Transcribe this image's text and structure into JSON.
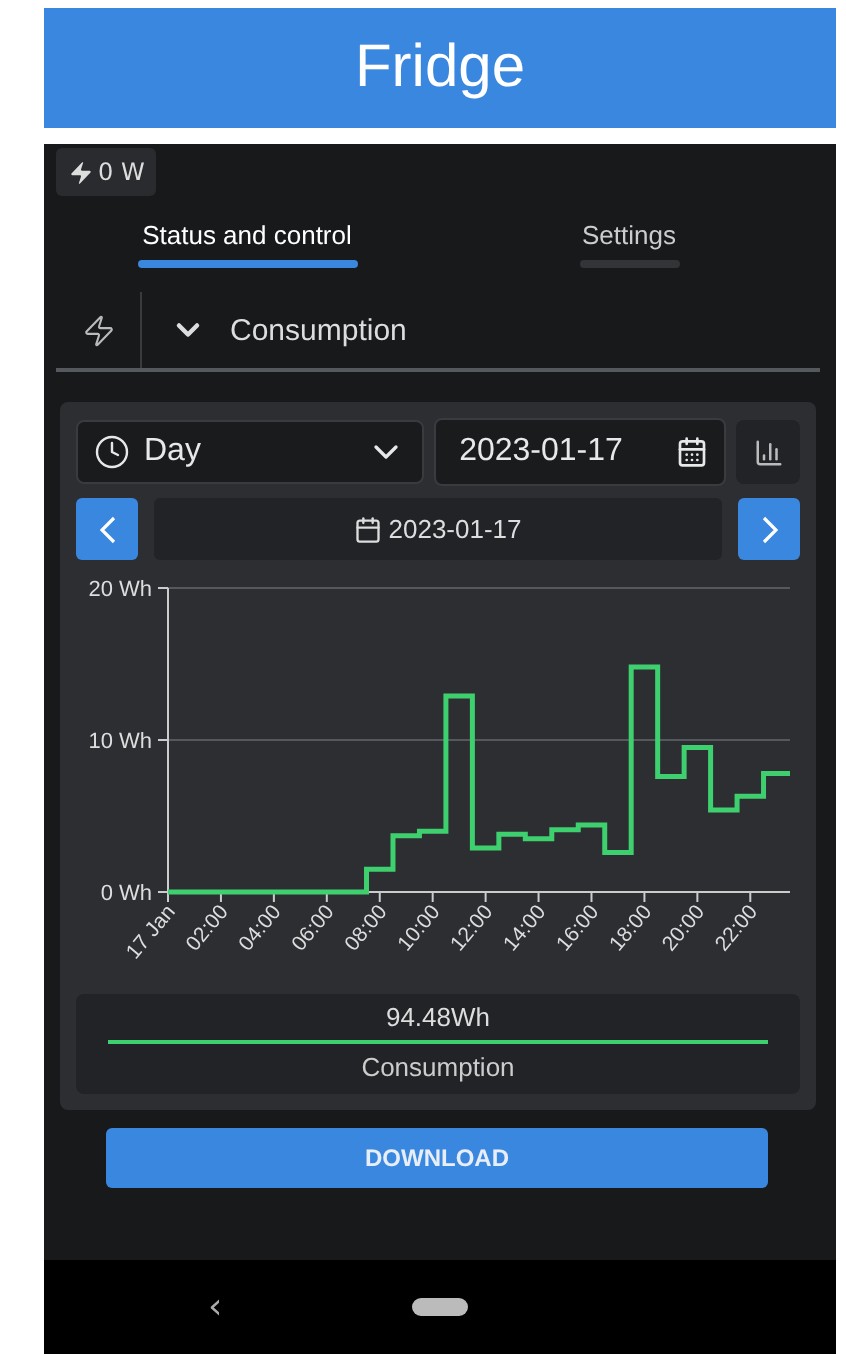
{
  "header": {
    "title": "Fridge"
  },
  "power_badge": {
    "value": "0 W"
  },
  "tabs": [
    {
      "label": "Status and control",
      "selected": true
    },
    {
      "label": "Settings",
      "selected": false
    }
  ],
  "section": {
    "title": "Consumption",
    "expanded": true
  },
  "period_select": {
    "value": "Day"
  },
  "date_field": {
    "value": "2023-01-17"
  },
  "date_nav": {
    "label": "2023-01-17"
  },
  "chart": {
    "chart_data": {
      "type": "line",
      "x": [
        0,
        0.5,
        0.5,
        1.5,
        1.5,
        2.5,
        2.5,
        3.5,
        3.5,
        4.5,
        4.5,
        5.5,
        5.5,
        6.5,
        6.5,
        7.5,
        7.5,
        8.5,
        8.5,
        9.5,
        9.5,
        10.5,
        10.5,
        11.5,
        11.5,
        12.5,
        12.5,
        13.5,
        13.5,
        14.5,
        14.5,
        15.5,
        15.5,
        16.5,
        16.5,
        17.5,
        17.5,
        18.5,
        18.5,
        19.5,
        19.5,
        20.5,
        20.5,
        21.5,
        21.5,
        22.5,
        22.5,
        23.5
      ],
      "series": [
        {
          "name": "Consumption",
          "color": "#3ecf6e",
          "values": [
            0,
            0,
            0,
            0,
            0,
            0,
            0,
            0,
            0,
            0,
            0,
            0,
            0,
            0,
            0,
            0,
            1.5,
            1.5,
            3.7,
            3.7,
            4.0,
            4.0,
            12.9,
            12.9,
            2.9,
            2.9,
            3.8,
            3.8,
            3.5,
            3.5,
            4.1,
            4.1,
            4.4,
            4.4,
            2.6,
            2.6,
            14.8,
            14.8,
            7.6,
            7.6,
            9.5,
            9.5,
            5.4,
            5.4,
            6.3,
            6.3,
            7.8,
            7.8
          ]
        }
      ],
      "xlim": [
        0,
        23.5
      ],
      "ylim": [
        0,
        20
      ],
      "xticks": [
        {
          "value": 0,
          "label": "17 Jan"
        },
        {
          "value": 2,
          "label": "02:00"
        },
        {
          "value": 4,
          "label": "04:00"
        },
        {
          "value": 6,
          "label": "06:00"
        },
        {
          "value": 8,
          "label": "08:00"
        },
        {
          "value": 10,
          "label": "10:00"
        },
        {
          "value": 12,
          "label": "12:00"
        },
        {
          "value": 14,
          "label": "14:00"
        },
        {
          "value": 16,
          "label": "16:00"
        },
        {
          "value": 18,
          "label": "18:00"
        },
        {
          "value": 20,
          "label": "20:00"
        },
        {
          "value": 22,
          "label": "22:00"
        }
      ],
      "yticks": [
        {
          "value": 0,
          "label": "0 Wh"
        },
        {
          "value": 10,
          "label": "10 Wh"
        },
        {
          "value": 20,
          "label": "20 Wh"
        }
      ]
    }
  },
  "legend": {
    "value": "94.48Wh"
  },
  "download_button": {
    "label": "DOWNLOAD"
  },
  "nav_bar": {
    "back": "‹"
  }
}
